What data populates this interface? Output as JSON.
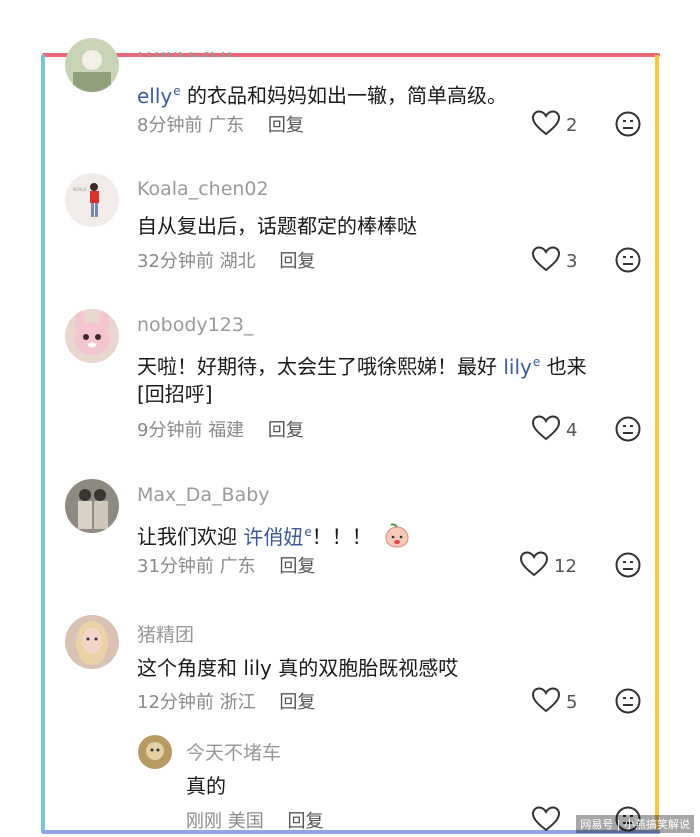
{
  "comments": [
    {
      "username": "Francesca",
      "text_mention": "elly",
      "text_rest": " 的衣品和妈妈如出一辙，简单高级。",
      "time": "8分钟前",
      "location": "广东",
      "reply": "回复",
      "likes": "2"
    },
    {
      "username": "Koala_chen02",
      "text": "自从复出后，话题都定的棒棒哒",
      "time": "32分钟前",
      "location": "湖北",
      "reply": "回复",
      "likes": "3"
    },
    {
      "username": "nobody123_",
      "text_pre": "天啦！好期待，太会生了哦徐熙娣！最好 ",
      "text_mention": "lily",
      "text_post": " 也来",
      "text_line2": "[回招呼]",
      "time": "9分钟前",
      "location": "福建",
      "reply": "回复",
      "likes": "4"
    },
    {
      "username": "Max_Da_Baby",
      "text_pre": "让我们欢迎 ",
      "text_mention": "许俏妞",
      "text_post": "！！！",
      "time": "31分钟前",
      "location": "广东",
      "reply": "回复",
      "likes": "12"
    },
    {
      "username": "猪精团",
      "text": "这个角度和 lily 真的双胞胎既视感哎",
      "time": "12分钟前",
      "location": "浙江",
      "reply": "回复",
      "likes": "5"
    }
  ],
  "sub_reply": {
    "username": "今天不堵车",
    "text": "真的",
    "time": "刚刚",
    "location": "美国",
    "reply": "回复"
  },
  "icons": {
    "like": "heart-outline-icon",
    "dislike": "neutral-face-icon",
    "mention": "search-icon",
    "emoji": "peach-face-emoji"
  },
  "watermark": "网易号 | 小燕搞笑解说",
  "colors": {
    "frame_top": "#e8687a",
    "frame_left": "#78c8cf",
    "frame_right": "#f0c84a",
    "frame_bottom": "#8fa6e6",
    "mention": "#3c5a9a"
  }
}
